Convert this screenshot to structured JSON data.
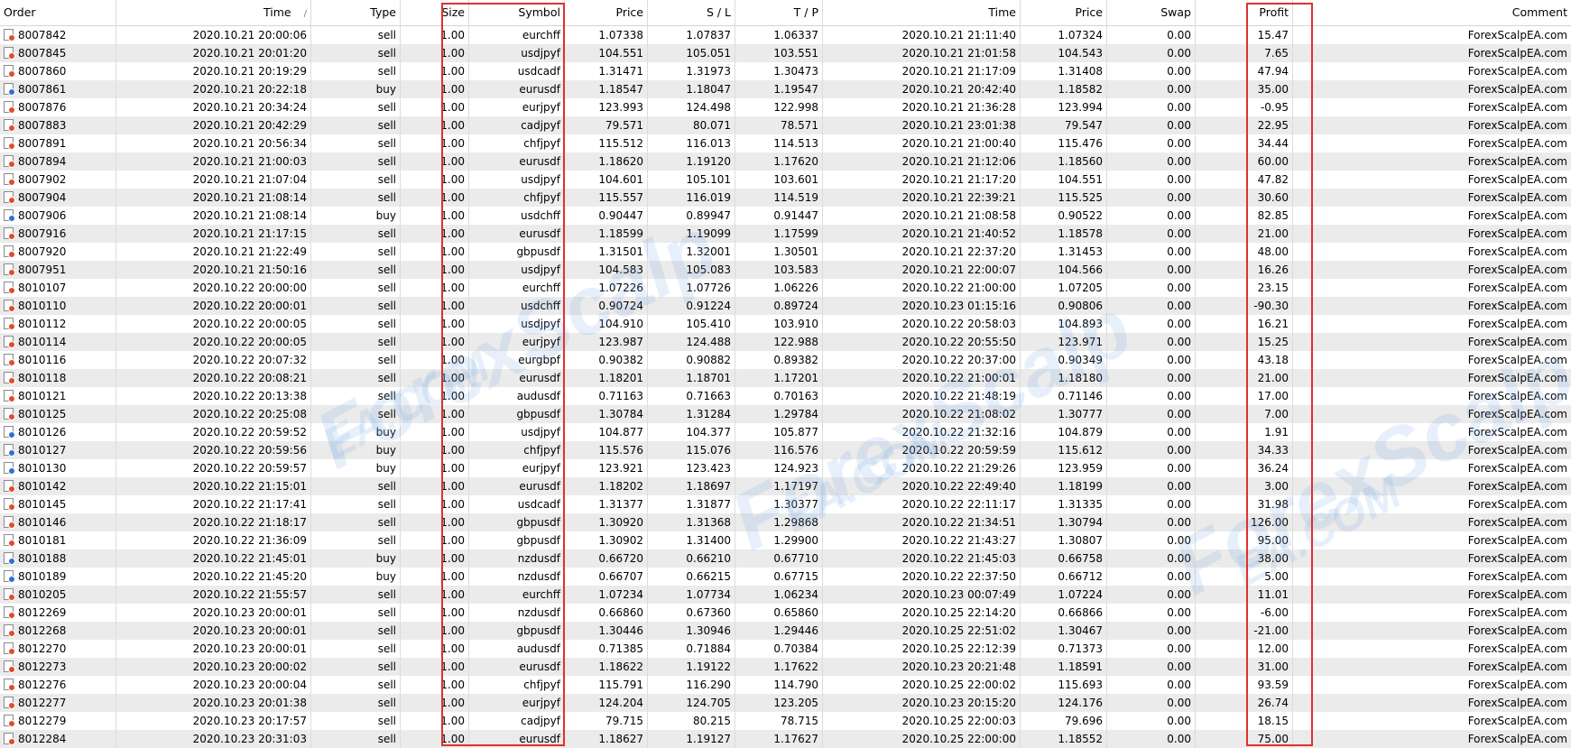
{
  "columns": {
    "order": "Order",
    "time": "Time",
    "type": "Type",
    "size": "Size",
    "symbol": "Symbol",
    "price": "Price",
    "sl": "S / L",
    "tp": "T / P",
    "close_time": "Time",
    "close_price": "Price",
    "swap": "Swap",
    "profit": "Profit",
    "comment": "Comment"
  },
  "sort_indicator": "/",
  "colors": {
    "highlight": "#e03030",
    "sell_icon": "#e24b2b",
    "buy_icon": "#2f6fd6"
  },
  "watermark": {
    "line1": "ForexScalp",
    "line2": "EA.COM"
  },
  "rows": [
    {
      "order": "8007842",
      "time": "2020.10.21 20:00:06",
      "type": "sell",
      "size": "1.00",
      "symbol": "eurchff",
      "price": "1.07338",
      "sl": "1.07837",
      "tp": "1.06337",
      "close_time": "2020.10.21 21:11:40",
      "close_price": "1.07324",
      "swap": "0.00",
      "profit": "15.47",
      "comment": "ForexScalpEA.com"
    },
    {
      "order": "8007845",
      "time": "2020.10.21 20:01:20",
      "type": "sell",
      "size": "1.00",
      "symbol": "usdjpyf",
      "price": "104.551",
      "sl": "105.051",
      "tp": "103.551",
      "close_time": "2020.10.21 21:01:58",
      "close_price": "104.543",
      "swap": "0.00",
      "profit": "7.65",
      "comment": "ForexScalpEA.com"
    },
    {
      "order": "8007860",
      "time": "2020.10.21 20:19:29",
      "type": "sell",
      "size": "1.00",
      "symbol": "usdcadf",
      "price": "1.31471",
      "sl": "1.31973",
      "tp": "1.30473",
      "close_time": "2020.10.21 21:17:09",
      "close_price": "1.31408",
      "swap": "0.00",
      "profit": "47.94",
      "comment": "ForexScalpEA.com"
    },
    {
      "order": "8007861",
      "time": "2020.10.21 20:22:18",
      "type": "buy",
      "size": "1.00",
      "symbol": "eurusdf",
      "price": "1.18547",
      "sl": "1.18047",
      "tp": "1.19547",
      "close_time": "2020.10.21 20:42:40",
      "close_price": "1.18582",
      "swap": "0.00",
      "profit": "35.00",
      "comment": "ForexScalpEA.com"
    },
    {
      "order": "8007876",
      "time": "2020.10.21 20:34:24",
      "type": "sell",
      "size": "1.00",
      "symbol": "eurjpyf",
      "price": "123.993",
      "sl": "124.498",
      "tp": "122.998",
      "close_time": "2020.10.21 21:36:28",
      "close_price": "123.994",
      "swap": "0.00",
      "profit": "-0.95",
      "comment": "ForexScalpEA.com"
    },
    {
      "order": "8007883",
      "time": "2020.10.21 20:42:29",
      "type": "sell",
      "size": "1.00",
      "symbol": "cadjpyf",
      "price": "79.571",
      "sl": "80.071",
      "tp": "78.571",
      "close_time": "2020.10.21 23:01:38",
      "close_price": "79.547",
      "swap": "0.00",
      "profit": "22.95",
      "comment": "ForexScalpEA.com"
    },
    {
      "order": "8007891",
      "time": "2020.10.21 20:56:34",
      "type": "sell",
      "size": "1.00",
      "symbol": "chfjpyf",
      "price": "115.512",
      "sl": "116.013",
      "tp": "114.513",
      "close_time": "2020.10.21 21:00:40",
      "close_price": "115.476",
      "swap": "0.00",
      "profit": "34.44",
      "comment": "ForexScalpEA.com"
    },
    {
      "order": "8007894",
      "time": "2020.10.21 21:00:03",
      "type": "sell",
      "size": "1.00",
      "symbol": "eurusdf",
      "price": "1.18620",
      "sl": "1.19120",
      "tp": "1.17620",
      "close_time": "2020.10.21 21:12:06",
      "close_price": "1.18560",
      "swap": "0.00",
      "profit": "60.00",
      "comment": "ForexScalpEA.com"
    },
    {
      "order": "8007902",
      "time": "2020.10.21 21:07:04",
      "type": "sell",
      "size": "1.00",
      "symbol": "usdjpyf",
      "price": "104.601",
      "sl": "105.101",
      "tp": "103.601",
      "close_time": "2020.10.21 21:17:20",
      "close_price": "104.551",
      "swap": "0.00",
      "profit": "47.82",
      "comment": "ForexScalpEA.com"
    },
    {
      "order": "8007904",
      "time": "2020.10.21 21:08:14",
      "type": "sell",
      "size": "1.00",
      "symbol": "chfjpyf",
      "price": "115.557",
      "sl": "116.019",
      "tp": "114.519",
      "close_time": "2020.10.21 22:39:21",
      "close_price": "115.525",
      "swap": "0.00",
      "profit": "30.60",
      "comment": "ForexScalpEA.com"
    },
    {
      "order": "8007906",
      "time": "2020.10.21 21:08:14",
      "type": "buy",
      "size": "1.00",
      "symbol": "usdchff",
      "price": "0.90447",
      "sl": "0.89947",
      "tp": "0.91447",
      "close_time": "2020.10.21 21:08:58",
      "close_price": "0.90522",
      "swap": "0.00",
      "profit": "82.85",
      "comment": "ForexScalpEA.com"
    },
    {
      "order": "8007916",
      "time": "2020.10.21 21:17:15",
      "type": "sell",
      "size": "1.00",
      "symbol": "eurusdf",
      "price": "1.18599",
      "sl": "1.19099",
      "tp": "1.17599",
      "close_time": "2020.10.21 21:40:52",
      "close_price": "1.18578",
      "swap": "0.00",
      "profit": "21.00",
      "comment": "ForexScalpEA.com"
    },
    {
      "order": "8007920",
      "time": "2020.10.21 21:22:49",
      "type": "sell",
      "size": "1.00",
      "symbol": "gbpusdf",
      "price": "1.31501",
      "sl": "1.32001",
      "tp": "1.30501",
      "close_time": "2020.10.21 22:37:20",
      "close_price": "1.31453",
      "swap": "0.00",
      "profit": "48.00",
      "comment": "ForexScalpEA.com"
    },
    {
      "order": "8007951",
      "time": "2020.10.21 21:50:16",
      "type": "sell",
      "size": "1.00",
      "symbol": "usdjpyf",
      "price": "104.583",
      "sl": "105.083",
      "tp": "103.583",
      "close_time": "2020.10.21 22:00:07",
      "close_price": "104.566",
      "swap": "0.00",
      "profit": "16.26",
      "comment": "ForexScalpEA.com"
    },
    {
      "order": "8010107",
      "time": "2020.10.22 20:00:00",
      "type": "sell",
      "size": "1.00",
      "symbol": "eurchff",
      "price": "1.07226",
      "sl": "1.07726",
      "tp": "1.06226",
      "close_time": "2020.10.22 21:00:00",
      "close_price": "1.07205",
      "swap": "0.00",
      "profit": "23.15",
      "comment": "ForexScalpEA.com"
    },
    {
      "order": "8010110",
      "time": "2020.10.22 20:00:01",
      "type": "sell",
      "size": "1.00",
      "symbol": "usdchff",
      "price": "0.90724",
      "sl": "0.91224",
      "tp": "0.89724",
      "close_time": "2020.10.23 01:15:16",
      "close_price": "0.90806",
      "swap": "0.00",
      "profit": "-90.30",
      "comment": "ForexScalpEA.com"
    },
    {
      "order": "8010112",
      "time": "2020.10.22 20:00:05",
      "type": "sell",
      "size": "1.00",
      "symbol": "usdjpyf",
      "price": "104.910",
      "sl": "105.410",
      "tp": "103.910",
      "close_time": "2020.10.22 20:58:03",
      "close_price": "104.893",
      "swap": "0.00",
      "profit": "16.21",
      "comment": "ForexScalpEA.com"
    },
    {
      "order": "8010114",
      "time": "2020.10.22 20:00:05",
      "type": "sell",
      "size": "1.00",
      "symbol": "eurjpyf",
      "price": "123.987",
      "sl": "124.488",
      "tp": "122.988",
      "close_time": "2020.10.22 20:55:50",
      "close_price": "123.971",
      "swap": "0.00",
      "profit": "15.25",
      "comment": "ForexScalpEA.com"
    },
    {
      "order": "8010116",
      "time": "2020.10.22 20:07:32",
      "type": "sell",
      "size": "1.00",
      "symbol": "eurgbpf",
      "price": "0.90382",
      "sl": "0.90882",
      "tp": "0.89382",
      "close_time": "2020.10.22 20:37:00",
      "close_price": "0.90349",
      "swap": "0.00",
      "profit": "43.18",
      "comment": "ForexScalpEA.com"
    },
    {
      "order": "8010118",
      "time": "2020.10.22 20:08:21",
      "type": "sell",
      "size": "1.00",
      "symbol": "eurusdf",
      "price": "1.18201",
      "sl": "1.18701",
      "tp": "1.17201",
      "close_time": "2020.10.22 21:00:01",
      "close_price": "1.18180",
      "swap": "0.00",
      "profit": "21.00",
      "comment": "ForexScalpEA.com"
    },
    {
      "order": "8010121",
      "time": "2020.10.22 20:13:38",
      "type": "sell",
      "size": "1.00",
      "symbol": "audusdf",
      "price": "0.71163",
      "sl": "0.71663",
      "tp": "0.70163",
      "close_time": "2020.10.22 21:48:19",
      "close_price": "0.71146",
      "swap": "0.00",
      "profit": "17.00",
      "comment": "ForexScalpEA.com"
    },
    {
      "order": "8010125",
      "time": "2020.10.22 20:25:08",
      "type": "sell",
      "size": "1.00",
      "symbol": "gbpusdf",
      "price": "1.30784",
      "sl": "1.31284",
      "tp": "1.29784",
      "close_time": "2020.10.22 21:08:02",
      "close_price": "1.30777",
      "swap": "0.00",
      "profit": "7.00",
      "comment": "ForexScalpEA.com"
    },
    {
      "order": "8010126",
      "time": "2020.10.22 20:59:52",
      "type": "buy",
      "size": "1.00",
      "symbol": "usdjpyf",
      "price": "104.877",
      "sl": "104.377",
      "tp": "105.877",
      "close_time": "2020.10.22 21:32:16",
      "close_price": "104.879",
      "swap": "0.00",
      "profit": "1.91",
      "comment": "ForexScalpEA.com"
    },
    {
      "order": "8010127",
      "time": "2020.10.22 20:59:56",
      "type": "buy",
      "size": "1.00",
      "symbol": "chfjpyf",
      "price": "115.576",
      "sl": "115.076",
      "tp": "116.576",
      "close_time": "2020.10.22 20:59:59",
      "close_price": "115.612",
      "swap": "0.00",
      "profit": "34.33",
      "comment": "ForexScalpEA.com"
    },
    {
      "order": "8010130",
      "time": "2020.10.22 20:59:57",
      "type": "buy",
      "size": "1.00",
      "symbol": "eurjpyf",
      "price": "123.921",
      "sl": "123.423",
      "tp": "124.923",
      "close_time": "2020.10.22 21:29:26",
      "close_price": "123.959",
      "swap": "0.00",
      "profit": "36.24",
      "comment": "ForexScalpEA.com"
    },
    {
      "order": "8010142",
      "time": "2020.10.22 21:15:01",
      "type": "sell",
      "size": "1.00",
      "symbol": "eurusdf",
      "price": "1.18202",
      "sl": "1.18697",
      "tp": "1.17197",
      "close_time": "2020.10.22 22:49:40",
      "close_price": "1.18199",
      "swap": "0.00",
      "profit": "3.00",
      "comment": "ForexScalpEA.com"
    },
    {
      "order": "8010145",
      "time": "2020.10.22 21:17:41",
      "type": "sell",
      "size": "1.00",
      "symbol": "usdcadf",
      "price": "1.31377",
      "sl": "1.31877",
      "tp": "1.30377",
      "close_time": "2020.10.22 22:11:17",
      "close_price": "1.31335",
      "swap": "0.00",
      "profit": "31.98",
      "comment": "ForexScalpEA.com"
    },
    {
      "order": "8010146",
      "time": "2020.10.22 21:18:17",
      "type": "sell",
      "size": "1.00",
      "symbol": "gbpusdf",
      "price": "1.30920",
      "sl": "1.31368",
      "tp": "1.29868",
      "close_time": "2020.10.22 21:34:51",
      "close_price": "1.30794",
      "swap": "0.00",
      "profit": "126.00",
      "comment": "ForexScalpEA.com"
    },
    {
      "order": "8010181",
      "time": "2020.10.22 21:36:09",
      "type": "sell",
      "size": "1.00",
      "symbol": "gbpusdf",
      "price": "1.30902",
      "sl": "1.31400",
      "tp": "1.29900",
      "close_time": "2020.10.22 21:43:27",
      "close_price": "1.30807",
      "swap": "0.00",
      "profit": "95.00",
      "comment": "ForexScalpEA.com"
    },
    {
      "order": "8010188",
      "time": "2020.10.22 21:45:01",
      "type": "buy",
      "size": "1.00",
      "symbol": "nzdusdf",
      "price": "0.66720",
      "sl": "0.66210",
      "tp": "0.67710",
      "close_time": "2020.10.22 21:45:03",
      "close_price": "0.66758",
      "swap": "0.00",
      "profit": "38.00",
      "comment": "ForexScalpEA.com"
    },
    {
      "order": "8010189",
      "time": "2020.10.22 21:45:20",
      "type": "buy",
      "size": "1.00",
      "symbol": "nzdusdf",
      "price": "0.66707",
      "sl": "0.66215",
      "tp": "0.67715",
      "close_time": "2020.10.22 22:37:50",
      "close_price": "0.66712",
      "swap": "0.00",
      "profit": "5.00",
      "comment": "ForexScalpEA.com"
    },
    {
      "order": "8010205",
      "time": "2020.10.22 21:55:57",
      "type": "sell",
      "size": "1.00",
      "symbol": "eurchff",
      "price": "1.07234",
      "sl": "1.07734",
      "tp": "1.06234",
      "close_time": "2020.10.23 00:07:49",
      "close_price": "1.07224",
      "swap": "0.00",
      "profit": "11.01",
      "comment": "ForexScalpEA.com"
    },
    {
      "order": "8012269",
      "time": "2020.10.23 20:00:01",
      "type": "sell",
      "size": "1.00",
      "symbol": "nzdusdf",
      "price": "0.66860",
      "sl": "0.67360",
      "tp": "0.65860",
      "close_time": "2020.10.25 22:14:20",
      "close_price": "0.66866",
      "swap": "0.00",
      "profit": "-6.00",
      "comment": "ForexScalpEA.com"
    },
    {
      "order": "8012268",
      "time": "2020.10.23 20:00:01",
      "type": "sell",
      "size": "1.00",
      "symbol": "gbpusdf",
      "price": "1.30446",
      "sl": "1.30946",
      "tp": "1.29446",
      "close_time": "2020.10.25 22:51:02",
      "close_price": "1.30467",
      "swap": "0.00",
      "profit": "-21.00",
      "comment": "ForexScalpEA.com"
    },
    {
      "order": "8012270",
      "time": "2020.10.23 20:00:01",
      "type": "sell",
      "size": "1.00",
      "symbol": "audusdf",
      "price": "0.71385",
      "sl": "0.71884",
      "tp": "0.70384",
      "close_time": "2020.10.25 22:12:39",
      "close_price": "0.71373",
      "swap": "0.00",
      "profit": "12.00",
      "comment": "ForexScalpEA.com"
    },
    {
      "order": "8012273",
      "time": "2020.10.23 20:00:02",
      "type": "sell",
      "size": "1.00",
      "symbol": "eurusdf",
      "price": "1.18622",
      "sl": "1.19122",
      "tp": "1.17622",
      "close_time": "2020.10.23 20:21:48",
      "close_price": "1.18591",
      "swap": "0.00",
      "profit": "31.00",
      "comment": "ForexScalpEA.com"
    },
    {
      "order": "8012276",
      "time": "2020.10.23 20:00:04",
      "type": "sell",
      "size": "1.00",
      "symbol": "chfjpyf",
      "price": "115.791",
      "sl": "116.290",
      "tp": "114.790",
      "close_time": "2020.10.25 22:00:02",
      "close_price": "115.693",
      "swap": "0.00",
      "profit": "93.59",
      "comment": "ForexScalpEA.com"
    },
    {
      "order": "8012277",
      "time": "2020.10.23 20:01:38",
      "type": "sell",
      "size": "1.00",
      "symbol": "eurjpyf",
      "price": "124.204",
      "sl": "124.705",
      "tp": "123.205",
      "close_time": "2020.10.23 20:15:20",
      "close_price": "124.176",
      "swap": "0.00",
      "profit": "26.74",
      "comment": "ForexScalpEA.com"
    },
    {
      "order": "8012279",
      "time": "2020.10.23 20:17:57",
      "type": "sell",
      "size": "1.00",
      "symbol": "cadjpyf",
      "price": "79.715",
      "sl": "80.215",
      "tp": "78.715",
      "close_time": "2020.10.25 22:00:03",
      "close_price": "79.696",
      "swap": "0.00",
      "profit": "18.15",
      "comment": "ForexScalpEA.com"
    },
    {
      "order": "8012284",
      "time": "2020.10.23 20:31:03",
      "type": "sell",
      "size": "1.00",
      "symbol": "eurusdf",
      "price": "1.18627",
      "sl": "1.19127",
      "tp": "1.17627",
      "close_time": "2020.10.25 22:00:00",
      "close_price": "1.18552",
      "swap": "0.00",
      "profit": "75.00",
      "comment": "ForexScalpEA.com"
    }
  ]
}
